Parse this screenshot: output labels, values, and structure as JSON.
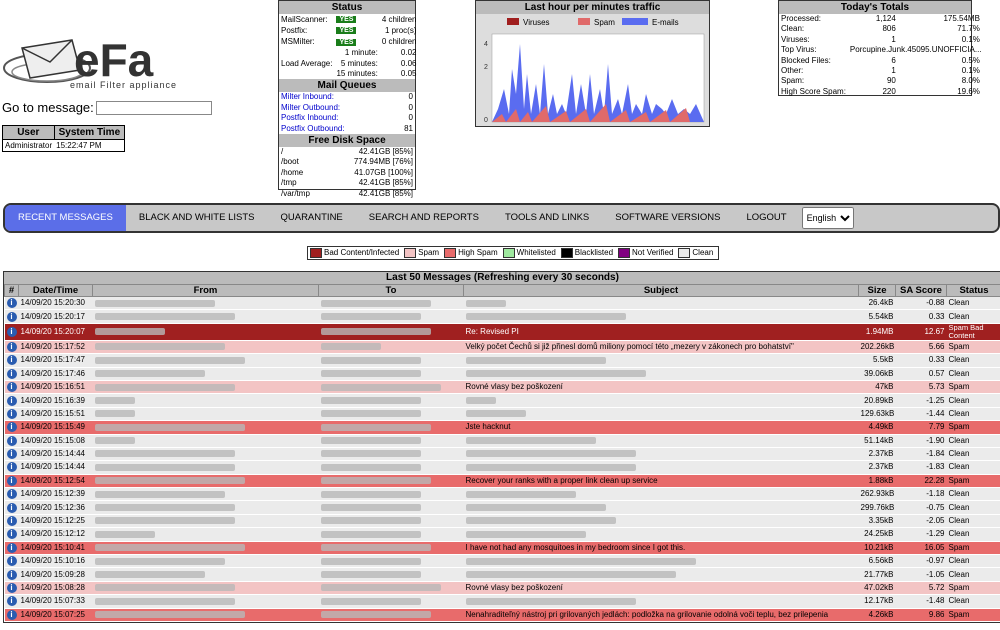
{
  "logo": {
    "brand": "eFa",
    "tagline": "email Filter appliance"
  },
  "goto": {
    "label": "Go to message:",
    "value": ""
  },
  "user_table": {
    "headers": [
      "User",
      "System Time"
    ],
    "user": "Administrator",
    "time": "15:22:47 PM"
  },
  "status": {
    "title": "Status",
    "rows": [
      {
        "label": "MailScanner:",
        "badge": "YES",
        "value": "4 children"
      },
      {
        "label": "Postfix:",
        "badge": "YES",
        "value": "1 proc(s)"
      },
      {
        "label": "MSMilter:",
        "badge": "YES",
        "value": "0 children"
      }
    ],
    "load_label": "Load Average:",
    "load": [
      {
        "label": "1 minute:",
        "value": "0.02"
      },
      {
        "label": "5 minutes:",
        "value": "0.06"
      },
      {
        "label": "15 minutes:",
        "value": "0.05"
      }
    ],
    "queues_title": "Mail Queues",
    "queues": [
      {
        "label": "Milter Inbound:",
        "value": "0"
      },
      {
        "label": "Milter Outbound:",
        "value": "0"
      },
      {
        "label": "Postfix Inbound:",
        "value": "0"
      },
      {
        "label": "Postfix Outbound:",
        "value": "81"
      }
    ],
    "disk_title": "Free Disk Space",
    "disk": [
      {
        "mount": "/",
        "value": "42.41GB [85%]"
      },
      {
        "mount": "/boot",
        "value": "774.94MB [76%]"
      },
      {
        "mount": "/home",
        "value": "41.07GB [100%]"
      },
      {
        "mount": "/tmp",
        "value": "42.41GB [85%]"
      },
      {
        "mount": "/var/tmp",
        "value": "42.41GB [85%]"
      }
    ]
  },
  "traffic": {
    "title": "Last hour per minutes traffic",
    "legend": [
      "Viruses",
      "Spam",
      "E-mails"
    ]
  },
  "totals": {
    "title": "Today's Totals",
    "rows": [
      {
        "label": "Processed:",
        "count": "1,124",
        "extra": "175.54MB"
      },
      {
        "label": "Clean:",
        "count": "806",
        "extra": "71.7%"
      },
      {
        "label": "Viruses:",
        "count": "1",
        "extra": "0.1%"
      },
      {
        "label": "Top Virus:",
        "count": "Porcupine.Junk.45095.UNOFFICIA...",
        "extra": ""
      },
      {
        "label": "Blocked Files:",
        "count": "6",
        "extra": "0.5%"
      },
      {
        "label": "Other:",
        "count": "1",
        "extra": "0.1%"
      },
      {
        "label": "Spam:",
        "count": "90",
        "extra": "8.0%"
      },
      {
        "label": "High Score Spam:",
        "count": "220",
        "extra": "19.6%"
      }
    ]
  },
  "nav": {
    "items": [
      "RECENT MESSAGES",
      "BLACK AND WHITE LISTS",
      "QUARANTINE",
      "SEARCH AND REPORTS",
      "TOOLS AND LINKS",
      "SOFTWARE VERSIONS",
      "LOGOUT"
    ],
    "language": "English"
  },
  "legend": [
    {
      "label": "Bad Content/Infected",
      "color": "#a02020"
    },
    {
      "label": "Spam",
      "color": "#f3c4c4"
    },
    {
      "label": "High Spam",
      "color": "#e86b6b"
    },
    {
      "label": "Whitelisted",
      "color": "#9ee89e"
    },
    {
      "label": "Blacklisted",
      "color": "#000000"
    },
    {
      "label": "Not Verified",
      "color": "#800080"
    },
    {
      "label": "Clean",
      "color": "#ebebeb"
    }
  ],
  "messages": {
    "title": "Last 50 Messages (Refreshing every 30 seconds)",
    "headers": [
      "#",
      "Date/Time",
      "From",
      "To",
      "Subject",
      "Size",
      "SA Score",
      "Status"
    ],
    "rows": [
      {
        "dt": "14/09/20 15:20:30",
        "subject": "",
        "size": "26.4kB",
        "score": "-0.88",
        "status": "Clean",
        "cls": "clean",
        "fw": 120,
        "tw": 110,
        "sw": 40
      },
      {
        "dt": "14/09/20 15:20:17",
        "subject": "",
        "size": "5.54kB",
        "score": "0.33",
        "status": "Clean",
        "cls": "clean",
        "fw": 140,
        "tw": 100,
        "sw": 160
      },
      {
        "dt": "14/09/20 15:20:07",
        "subject": "Re: Revised PI",
        "size": "1.94MB",
        "score": "12.67",
        "status": "Spam Bad Content",
        "cls": "bad",
        "fw": 70,
        "tw": 110,
        "sw": 0
      },
      {
        "dt": "14/09/20 15:17:52",
        "subject": "Velký počet Čechů si již přinesl domů miliony pomocí této „mezery v zákonech pro bohatství\"",
        "size": "202.26kB",
        "score": "5.66",
        "status": "Spam",
        "cls": "spam",
        "fw": 130,
        "tw": 60,
        "sw": 0
      },
      {
        "dt": "14/09/20 15:17:47",
        "subject": "",
        "size": "5.5kB",
        "score": "0.33",
        "status": "Clean",
        "cls": "clean",
        "fw": 150,
        "tw": 100,
        "sw": 140
      },
      {
        "dt": "14/09/20 15:17:46",
        "subject": "",
        "size": "39.06kB",
        "score": "0.57",
        "status": "Clean",
        "cls": "clean",
        "fw": 110,
        "tw": 100,
        "sw": 180
      },
      {
        "dt": "14/09/20 15:16:51",
        "subject": "Rovné vlasy bez poškození",
        "size": "47kB",
        "score": "5.73",
        "status": "Spam",
        "cls": "spam",
        "fw": 140,
        "tw": 120,
        "sw": 0
      },
      {
        "dt": "14/09/20 15:16:39",
        "subject": "",
        "size": "20.89kB",
        "score": "-1.25",
        "status": "Clean",
        "cls": "clean",
        "fw": 40,
        "tw": 100,
        "sw": 30
      },
      {
        "dt": "14/09/20 15:15:51",
        "subject": "",
        "size": "129.63kB",
        "score": "-1.44",
        "status": "Clean",
        "cls": "clean",
        "fw": 40,
        "tw": 100,
        "sw": 60
      },
      {
        "dt": "14/09/20 15:15:49",
        "subject": "Jste hacknut",
        "size": "4.49kB",
        "score": "7.79",
        "status": "Spam",
        "cls": "highspam",
        "fw": 150,
        "tw": 110,
        "sw": 0
      },
      {
        "dt": "14/09/20 15:15:08",
        "subject": "",
        "size": "51.14kB",
        "score": "-1.90",
        "status": "Clean",
        "cls": "clean",
        "fw": 40,
        "tw": 100,
        "sw": 130
      },
      {
        "dt": "14/09/20 15:14:44",
        "subject": "",
        "size": "2.37kB",
        "score": "-1.84",
        "status": "Clean",
        "cls": "clean",
        "fw": 140,
        "tw": 100,
        "sw": 170
      },
      {
        "dt": "14/09/20 15:14:44",
        "subject": "",
        "size": "2.37kB",
        "score": "-1.83",
        "status": "Clean",
        "cls": "clean",
        "fw": 140,
        "tw": 100,
        "sw": 170
      },
      {
        "dt": "14/09/20 15:12:54",
        "subject": "Recover your ranks with a proper link clean up service",
        "size": "1.88kB",
        "score": "22.28",
        "status": "Spam",
        "cls": "highspam",
        "fw": 150,
        "tw": 110,
        "sw": 0
      },
      {
        "dt": "14/09/20 15:12:39",
        "subject": "",
        "size": "262.93kB",
        "score": "-1.18",
        "status": "Clean",
        "cls": "clean",
        "fw": 130,
        "tw": 100,
        "sw": 110
      },
      {
        "dt": "14/09/20 15:12:36",
        "subject": "",
        "size": "299.76kB",
        "score": "-0.75",
        "status": "Clean",
        "cls": "clean",
        "fw": 140,
        "tw": 100,
        "sw": 140
      },
      {
        "dt": "14/09/20 15:12:25",
        "subject": "",
        "size": "3.35kB",
        "score": "-2.05",
        "status": "Clean",
        "cls": "clean",
        "fw": 140,
        "tw": 100,
        "sw": 150
      },
      {
        "dt": "14/09/20 15:12:12",
        "subject": "",
        "size": "24.25kB",
        "score": "-1.29",
        "status": "Clean",
        "cls": "clean",
        "fw": 60,
        "tw": 100,
        "sw": 120
      },
      {
        "dt": "14/09/20 15:10:41",
        "subject": "I have not had any mosquitoes in my bedroom since I got this.",
        "size": "10.21kB",
        "score": "16.05",
        "status": "Spam",
        "cls": "highspam",
        "fw": 150,
        "tw": 110,
        "sw": 0
      },
      {
        "dt": "14/09/20 15:10:16",
        "subject": "",
        "size": "6.56kB",
        "score": "-0.97",
        "status": "Clean",
        "cls": "clean",
        "fw": 130,
        "tw": 100,
        "sw": 230
      },
      {
        "dt": "14/09/20 15:09:28",
        "subject": "",
        "size": "21.77kB",
        "score": "-1.05",
        "status": "Clean",
        "cls": "clean",
        "fw": 110,
        "tw": 100,
        "sw": 210
      },
      {
        "dt": "14/09/20 15:08:28",
        "subject": "Rovné vlasy bez poškození",
        "size": "47.02kB",
        "score": "5.72",
        "status": "Spam",
        "cls": "spam",
        "fw": 140,
        "tw": 120,
        "sw": 0
      },
      {
        "dt": "14/09/20 15:07:33",
        "subject": "",
        "size": "12.17kB",
        "score": "-1.48",
        "status": "Clean",
        "cls": "clean",
        "fw": 140,
        "tw": 100,
        "sw": 170
      },
      {
        "dt": "14/09/20 15:07:25",
        "subject": "Nenahraditeľný nástroj pri grilovaných jedlách: podložka na grilovanie odolná voči teplu, bez prilepenia",
        "size": "4.26kB",
        "score": "9.86",
        "status": "Spam",
        "cls": "highspam",
        "fw": 150,
        "tw": 110,
        "sw": 0
      }
    ]
  }
}
